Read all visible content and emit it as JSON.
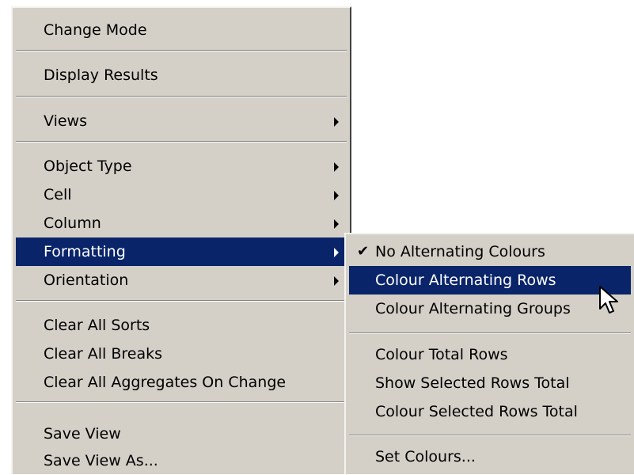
{
  "main_menu": {
    "change_mode": "Change Mode",
    "display_results": "Display Results",
    "views": "Views",
    "object_type": "Object Type",
    "cell": "Cell",
    "column": "Column",
    "formatting": "Formatting",
    "orientation": "Orientation",
    "clear_all_sorts": "Clear All Sorts",
    "clear_all_breaks": "Clear All Breaks",
    "clear_all_aggregates": "Clear All Aggregates On Change",
    "save_view": "Save View",
    "save_view_as": "Save View As..."
  },
  "formatting_submenu": {
    "no_alternating": "No Alternating Colours",
    "alternating_rows": "Colour Alternating Rows",
    "alternating_groups": "Colour Alternating Groups",
    "total_rows": "Colour Total Rows",
    "show_selected_total": "Show Selected Rows Total",
    "colour_selected_total": "Colour Selected Rows Total",
    "set_colours": "Set Colours..."
  },
  "checked_item": "No Alternating Colours",
  "colors": {
    "menu_bg": "#d4d0c8",
    "highlight": "#0a246a",
    "highlight_text": "#ffffff"
  }
}
